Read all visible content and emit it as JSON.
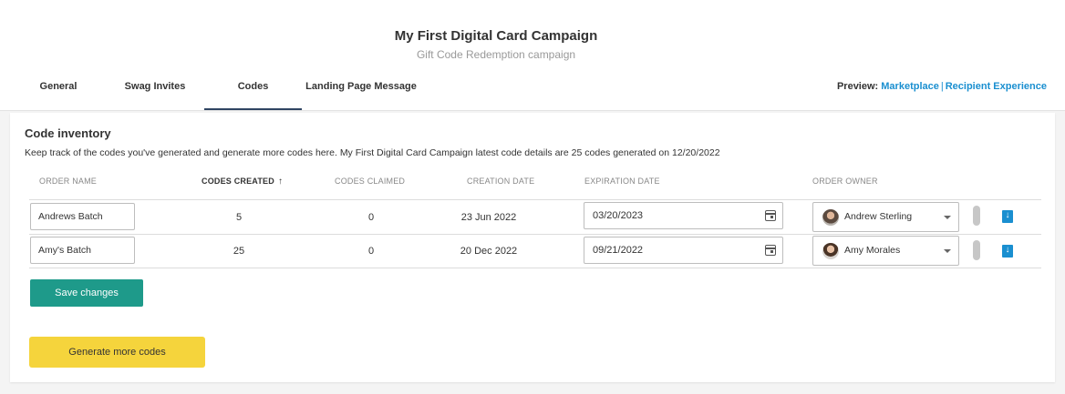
{
  "header": {
    "title": "My First Digital Card Campaign",
    "subtitle": "Gift Code Redemption campaign"
  },
  "tabs": [
    {
      "label": "General",
      "active": false
    },
    {
      "label": "Swag Invites",
      "active": false
    },
    {
      "label": "Codes",
      "active": true
    },
    {
      "label": "Landing Page Message",
      "active": false
    }
  ],
  "preview": {
    "label": "Preview:",
    "marketplace": "Marketplace",
    "separator": "|",
    "recipient": "Recipient Experience"
  },
  "inventory": {
    "title": "Code inventory",
    "description": "Keep track of the codes you've generated and generate more codes here. My First Digital Card Campaign latest code details are 25 codes generated on 12/20/2022",
    "columns": {
      "order_name": "ORDER NAME",
      "codes_created": "CODES CREATED",
      "codes_claimed": "CODES CLAIMED",
      "creation_date": "CREATION DATE",
      "expiration_date": "EXPIRATION DATE",
      "order_owner": "ORDER OWNER"
    },
    "sort_icon": "arrow-up-icon",
    "rows": [
      {
        "order_name": "Andrews Batch",
        "codes_created": "5",
        "codes_claimed": "0",
        "creation_date": "23 Jun 2022",
        "expiration_date": "03/20/2023",
        "owner": "Andrew Sterling"
      },
      {
        "order_name": "Amy's Batch",
        "codes_created": "25",
        "codes_claimed": "0",
        "creation_date": "20 Dec 2022",
        "expiration_date": "09/21/2022",
        "owner": "Amy Morales"
      }
    ],
    "save_label": "Save changes",
    "generate_label": "Generate more codes"
  },
  "colors": {
    "accent_blue": "#1a8fd0",
    "save_teal": "#1e9a8a",
    "generate_yellow": "#f5d43c",
    "tab_underline": "#2f4462"
  }
}
